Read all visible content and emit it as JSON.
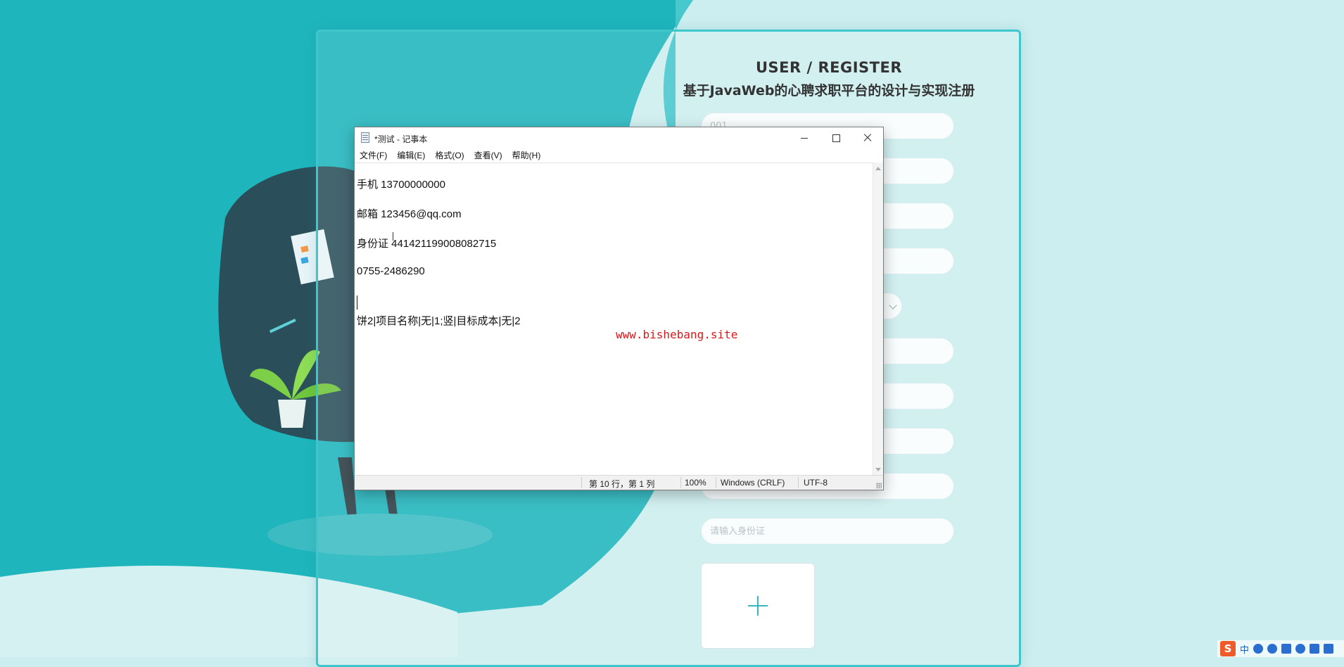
{
  "register": {
    "title_en": "USER / REGISTER",
    "title_cn": "基于JavaWeb的心聘求职平台的设计与实现注册",
    "first_field_value": "001",
    "id_card_placeholder": "请输入身份证",
    "upload_plus": "+"
  },
  "notepad": {
    "window_title": "*测试 - 记事本",
    "menus": [
      "文件(F)",
      "编辑(E)",
      "格式(O)",
      "查看(V)",
      "帮助(H)"
    ],
    "lines": [
      "手机 13700000000",
      "邮箱 123456@qq.com",
      "身份证 441421199008082715",
      "0755-2486290",
      "",
      "饼2|项目名称|无|1;竖|目标成本|无|2"
    ],
    "status": {
      "position": "第 10 行，第 1 列",
      "zoom": "100%",
      "line_ending": "Windows (CRLF)",
      "encoding": "UTF-8"
    }
  },
  "watermark": "www.bishebang.site",
  "tray": {
    "ime_logo": "S",
    "ime_mode": "中"
  },
  "colors": {
    "teal_dark": "#1fb5bd",
    "teal_mid": "#46c8cd",
    "teal_light": "#cdeef0",
    "accent_red": "#d7191c"
  }
}
